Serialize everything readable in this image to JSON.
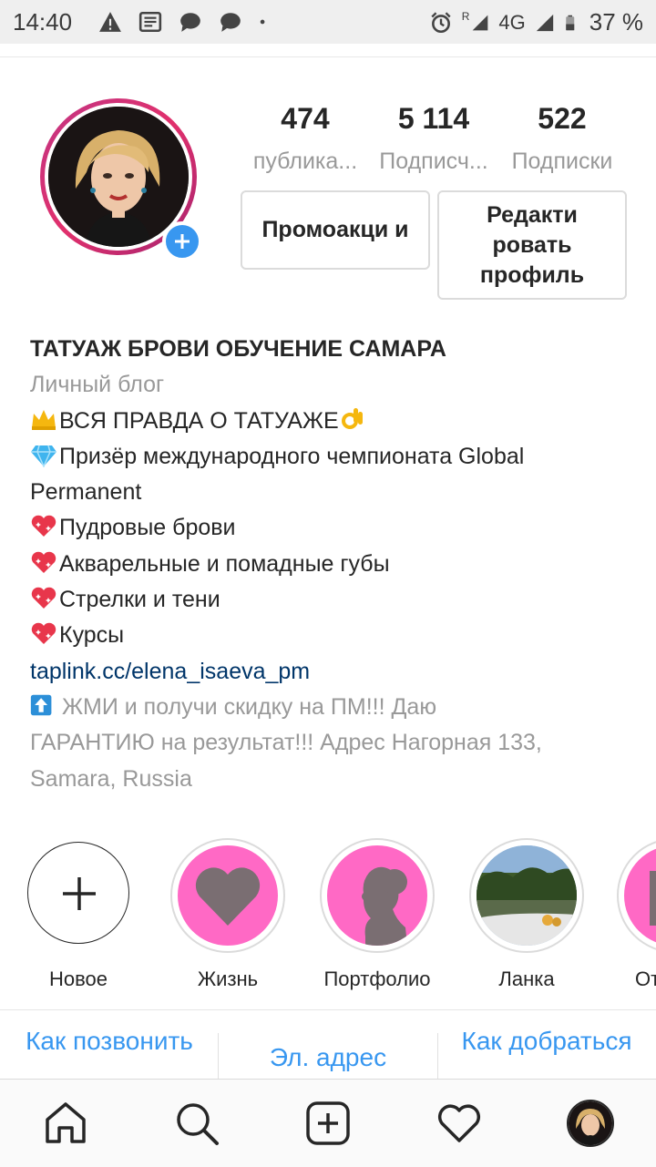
{
  "status_bar": {
    "time": "14:40",
    "network": "4G",
    "roaming": "R",
    "battery": "37 %",
    "icons": [
      "warning-icon",
      "news-icon",
      "chat-icon",
      "chat-icon",
      "dot-icon",
      "alarm-icon",
      "signal-icon",
      "signal-icon",
      "battery-icon"
    ]
  },
  "profile": {
    "stats": [
      {
        "count": "474",
        "label": "публика..."
      },
      {
        "count": "5 114",
        "label": "Подписч..."
      },
      {
        "count": "522",
        "label": "Подписки"
      }
    ],
    "promo_button": "Промоакци и",
    "edit_button": "Редакти ровать профиль"
  },
  "bio": {
    "name": "ТАТУАЖ БРОВИ ОБУЧЕНИЕ САМАРА",
    "category": "Личный блог",
    "line1": "ВСЯ ПРАВДА О ТАТУАЖЕ",
    "line2a": "Призёр международного чемпионата Global",
    "line2b": "Permanent",
    "line3": "Пудровые брови",
    "line4": "Акварельные и помадные губы",
    "line5": "Стрелки и тени",
    "line6": "Курсы",
    "link": "taplink.cc/elena_isaeva_pm",
    "loc1": " ЖМИ и получи скидку на ПМ!!! Даю",
    "loc2": "ГАРАНТИЮ на результат!!! Адрес Нагорная 133,",
    "loc3": "Samara, Russia"
  },
  "highlights": [
    {
      "label": "Новое"
    },
    {
      "label": "Жизнь"
    },
    {
      "label": "Портфолио"
    },
    {
      "label": "Ланка"
    },
    {
      "label": "От"
    }
  ],
  "contact": {
    "call": "Как позвонить",
    "email": "Эл. адрес",
    "directions": "Как добраться"
  },
  "colors": {
    "accent": "#3897f0",
    "highlight_pink": "#ff69c5",
    "link": "#003569"
  }
}
